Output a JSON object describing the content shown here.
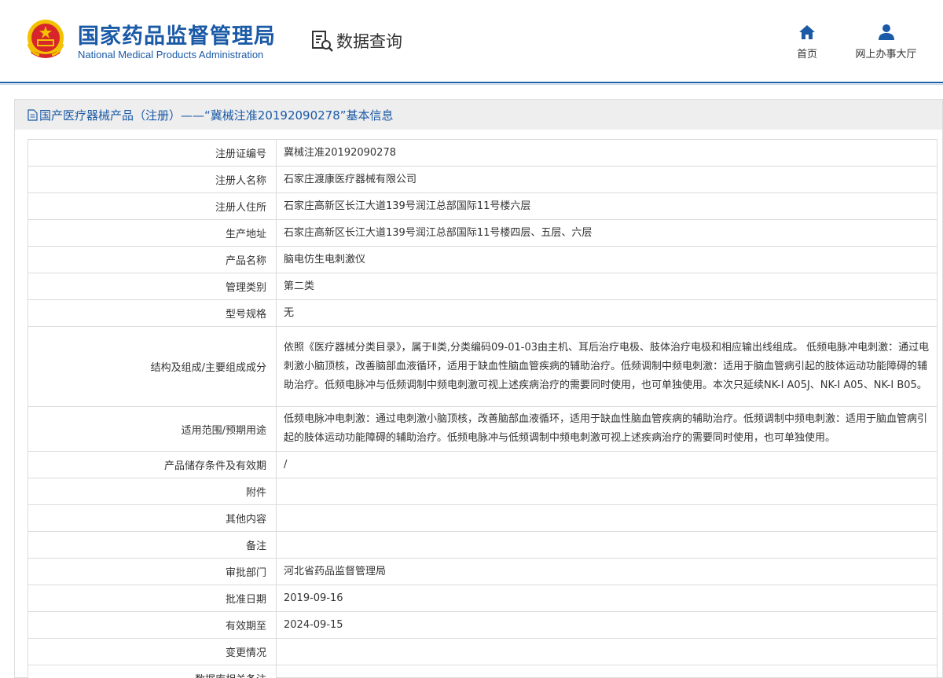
{
  "header": {
    "org_name_cn": "国家药品监督管理局",
    "org_name_en": "National Medical Products Administration",
    "data_query": "数据查询",
    "nav": {
      "home": "首页",
      "online_hall": "网上办事大厅"
    }
  },
  "colors": {
    "brand_blue": "#1a5aa6",
    "emblem_red": "#d7262b",
    "emblem_gold": "#f2c100"
  },
  "icons": {
    "emblem": "national-emblem-icon",
    "data_query": "document-search-icon",
    "home": "home-icon",
    "user": "user-icon",
    "title": "document-icon"
  },
  "panel": {
    "title": "国产医疗器械产品（注册）——“冀械注准20192090278”基本信息"
  },
  "rows": [
    {
      "label": "注册证编号",
      "value": "冀械注准20192090278"
    },
    {
      "label": "注册人名称",
      "value": "石家庄渡康医疗器械有限公司"
    },
    {
      "label": "注册人住所",
      "value": "石家庄高新区长江大道139号润江总部国际11号楼六层"
    },
    {
      "label": "生产地址",
      "value": "石家庄高新区长江大道139号润江总部国际11号楼四层、五层、六层"
    },
    {
      "label": "产品名称",
      "value": "脑电仿生电刺激仪"
    },
    {
      "label": "管理类别",
      "value": "第二类"
    },
    {
      "label": "型号规格",
      "value": "无"
    },
    {
      "label": "结构及组成/主要组成成分",
      "value": "依照《医疗器械分类目录》，属于Ⅱ类,分类编码09-01-03由主机、耳后治疗电极、肢体治疗电极和相应输出线组成。 低频电脉冲电刺激：通过电刺激小脑顶核，改善脑部血液循环，适用于缺血性脑血管疾病的辅助治疗。低频调制中频电刺激：适用于脑血管病引起的肢体运动功能障碍的辅助治疗。低频电脉冲与低频调制中频电刺激可视上述疾病治疗的需要同时使用，也可单独使用。本次只延续NK-I A05J、NK-I A05、NK-I B05。"
    },
    {
      "label": "适用范围/预期用途",
      "value": "低频电脉冲电刺激：通过电刺激小脑顶核，改善脑部血液循环，适用于缺血性脑血管疾病的辅助治疗。低频调制中频电刺激：适用于脑血管病引起的肢体运动功能障碍的辅助治疗。低频电脉冲与低频调制中频电刺激可视上述疾病治疗的需要同时使用，也可单独使用。"
    },
    {
      "label": "产品储存条件及有效期",
      "value": "/"
    },
    {
      "label": "附件",
      "value": ""
    },
    {
      "label": "其他内容",
      "value": ""
    },
    {
      "label": "备注",
      "value": ""
    },
    {
      "label": "审批部门",
      "value": "河北省药品监督管理局"
    },
    {
      "label": "批准日期",
      "value": "2019-09-16"
    },
    {
      "label": "有效期至",
      "value": "2024-09-15"
    },
    {
      "label": "变更情况",
      "value": ""
    },
    {
      "label": "数据库相关备注",
      "value": ""
    }
  ]
}
